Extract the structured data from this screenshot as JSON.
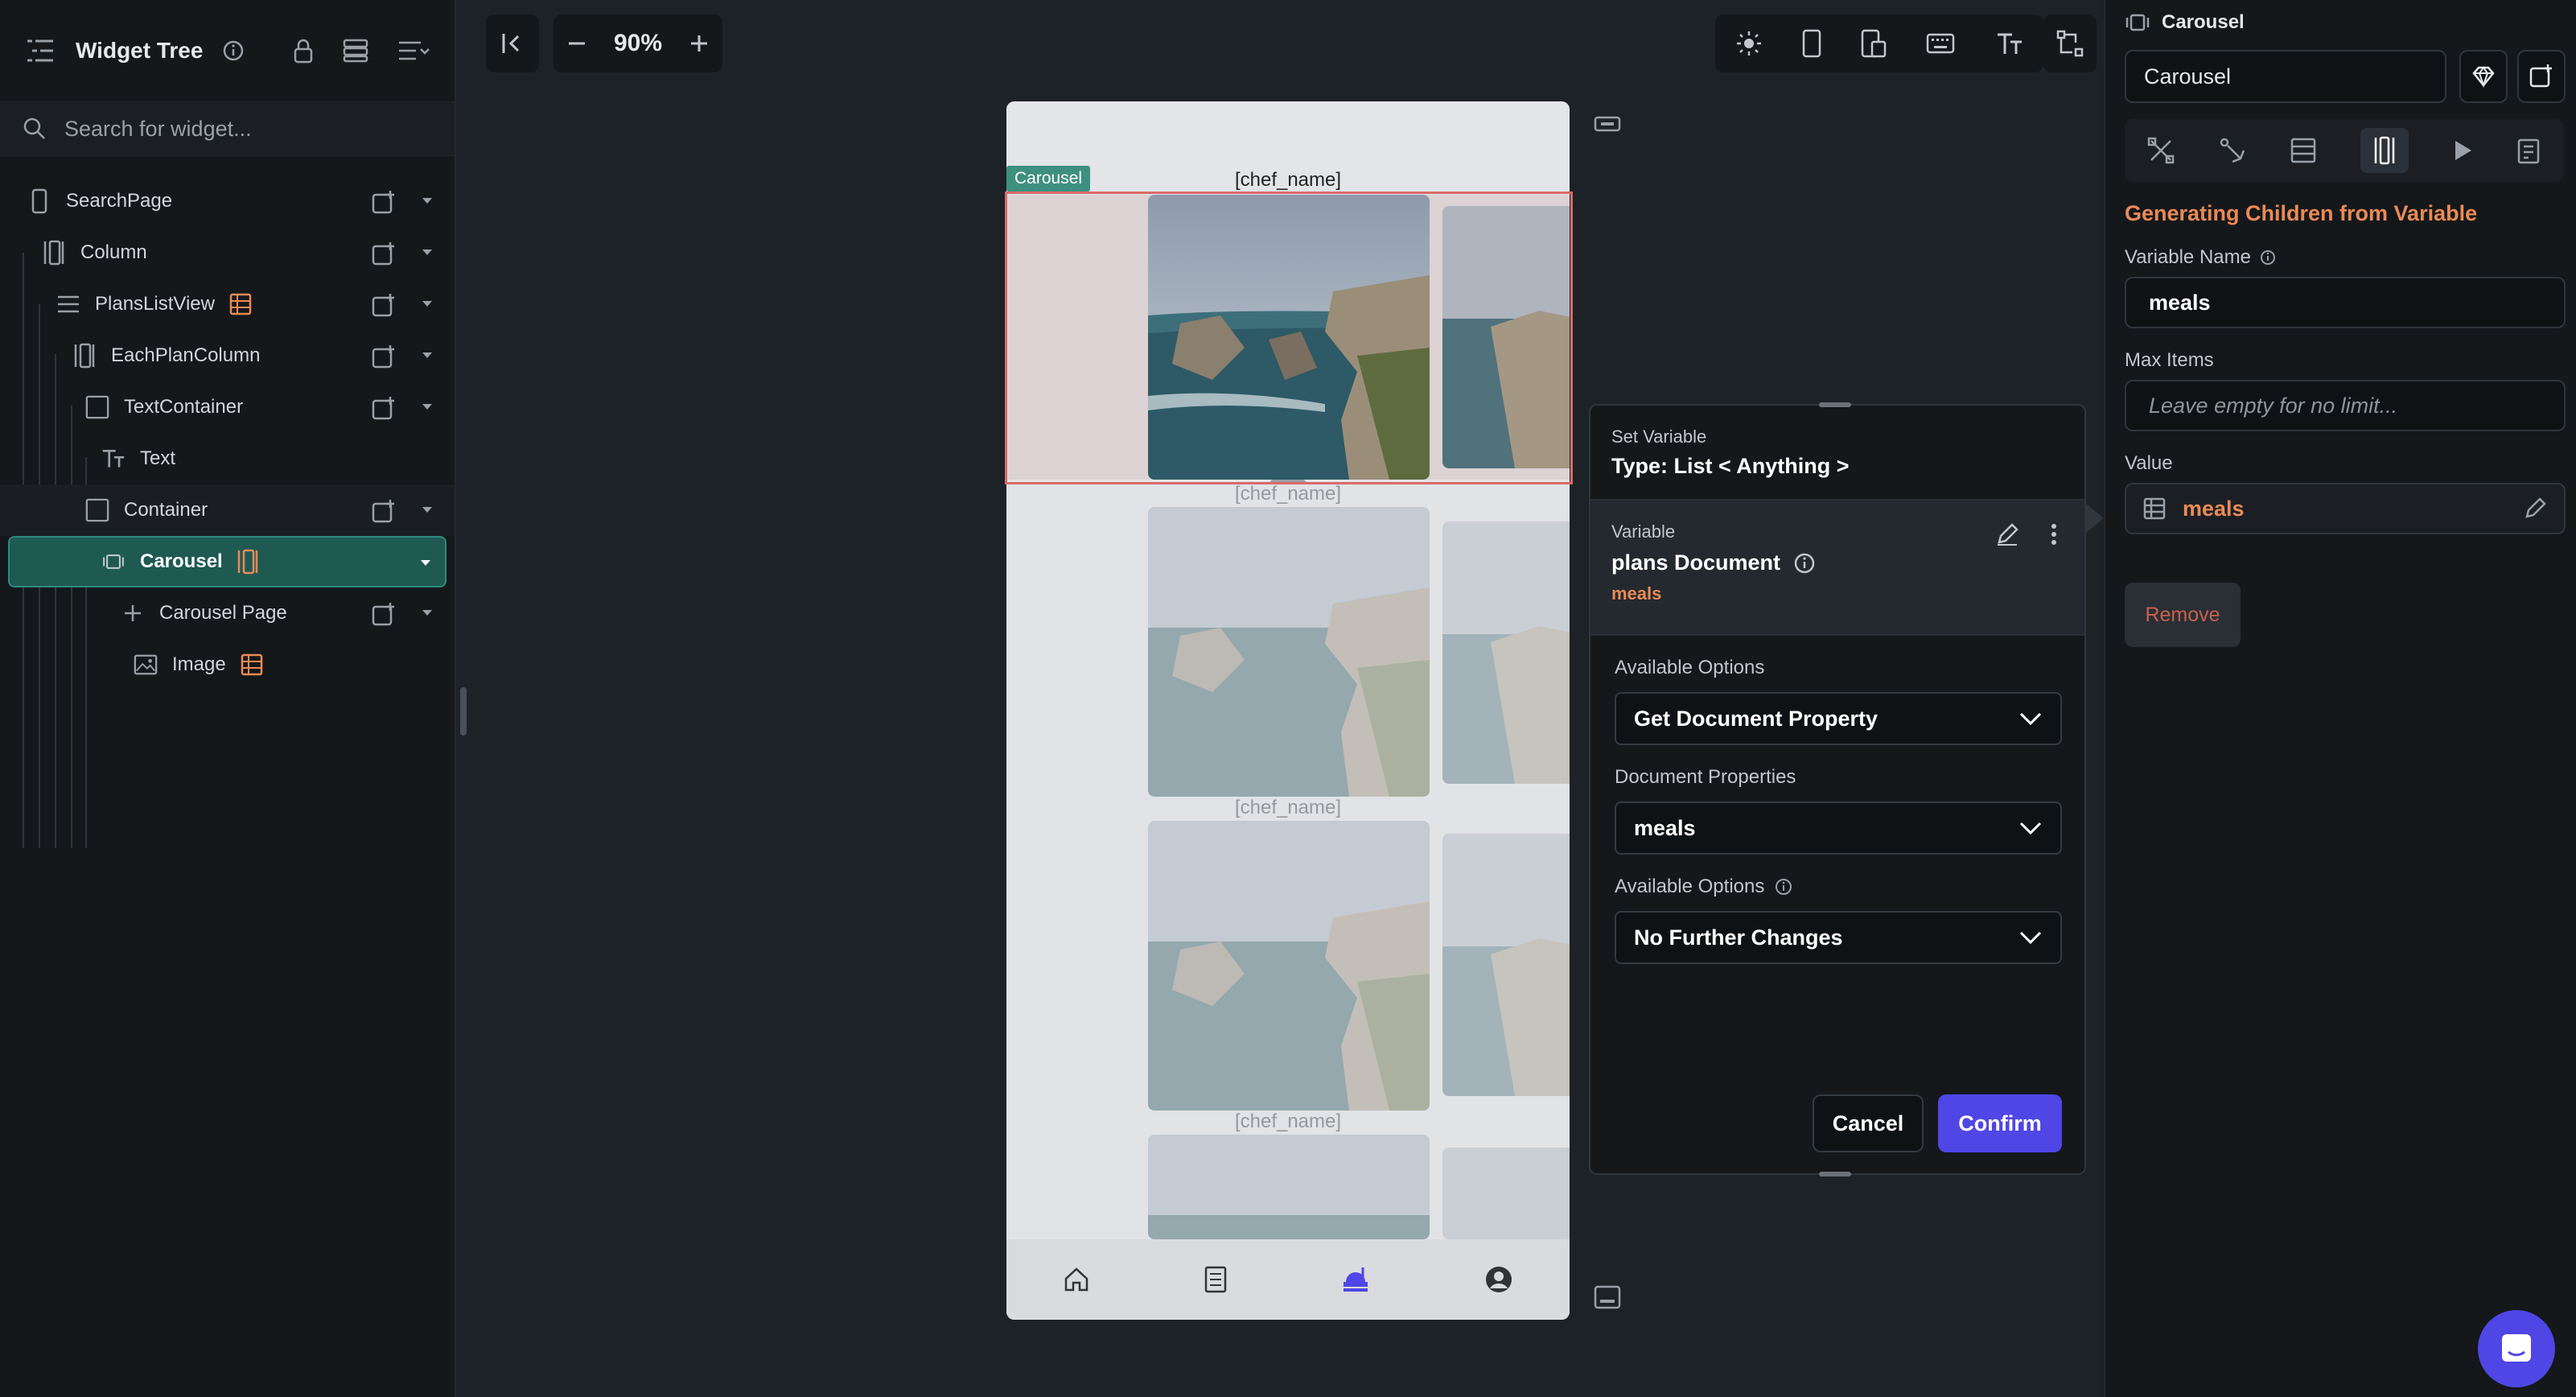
{
  "left_panel": {
    "title": "Widget Tree",
    "search_placeholder": "Search for widget...",
    "tree": [
      {
        "label": "SearchPage",
        "icon": "phone-icon"
      },
      {
        "label": "Column",
        "icon": "column-icon"
      },
      {
        "label": "PlansListView",
        "icon": "listview-icon"
      },
      {
        "label": "EachPlanColumn",
        "icon": "column-icon"
      },
      {
        "label": "TextContainer",
        "icon": "container-icon"
      },
      {
        "label": "Text",
        "icon": "text-icon"
      },
      {
        "label": "Container",
        "icon": "container-icon"
      },
      {
        "label": "Carousel",
        "icon": "carousel-icon"
      },
      {
        "label": "Carousel Page",
        "icon": "plus-icon"
      },
      {
        "label": "Image",
        "icon": "image-icon"
      }
    ]
  },
  "toolbar": {
    "zoom": "90%"
  },
  "canvas": {
    "carousel_tag": "Carousel",
    "chef_names": [
      "[chef_name]",
      "[chef_name]",
      "[chef_name]",
      "[chef_name]"
    ]
  },
  "set_variable": {
    "title": "Set Variable",
    "type": "Type: List < Anything >",
    "variable_label": "Variable",
    "variable_name": "plans Document",
    "variable_field": "meals",
    "available_options_label": "Available Options",
    "available_options_value": "Get Document Property",
    "document_properties_label": "Document Properties",
    "document_properties_value": "meals",
    "available_options2_label": "Available Options",
    "available_options2_value": "No Further Changes",
    "cancel": "Cancel",
    "confirm": "Confirm"
  },
  "right_panel": {
    "header": "Carousel",
    "widget_name": "Carousel",
    "section_title": "Generating Children from Variable",
    "variable_name_label": "Variable Name",
    "variable_name_value": "meals",
    "max_items_label": "Max Items",
    "max_items_placeholder": "Leave empty for no limit...",
    "value_label": "Value",
    "value_value": "meals",
    "remove": "Remove"
  },
  "colors": {
    "accent": "#4f46e5",
    "orange": "#ea8a55",
    "selected_tree": "#1e5a52"
  }
}
